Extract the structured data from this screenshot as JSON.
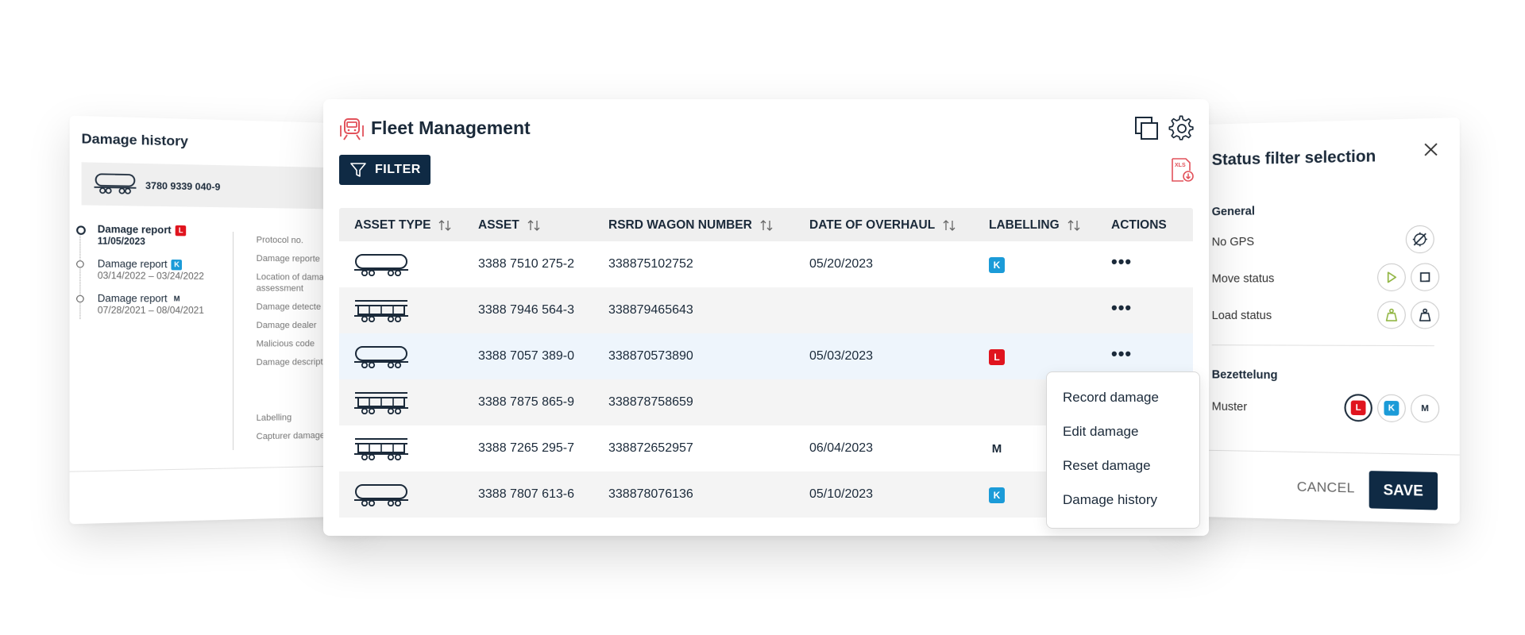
{
  "damage_history": {
    "title": "Damage history",
    "asset_number": "3780 9339 040-9",
    "reports": [
      {
        "title": "Damage report",
        "badge": "L",
        "date": "11/05/2023"
      },
      {
        "title": "Damage report",
        "badge": "K",
        "date": "03/14/2022 – 03/24/2022"
      },
      {
        "title": "Damage report",
        "badge": "M",
        "date": "07/28/2021 – 08/04/2021"
      }
    ],
    "fields": {
      "protocol": "Protocol no.",
      "reported": "Damage reporte",
      "location_1": "Location of dama",
      "location_2": "assessment",
      "detected": "Damage detecte",
      "dealer": "Damage dealer",
      "malicious": "Malicious code",
      "description": "Damage descript",
      "labelling": "Labelling",
      "capturer": "Capturer damage"
    }
  },
  "fleet": {
    "title": "Fleet Management",
    "filter_label": "FILTER",
    "xls_label": "XLS",
    "columns": {
      "asset_type": "ASSET TYPE",
      "asset": "ASSET",
      "rsrd": "RSRD WAGON NUMBER",
      "overhaul": "DATE OF OVERHAUL",
      "labelling": "LABELLING",
      "actions": "ACTIONS"
    },
    "rows": [
      {
        "type": "tank",
        "asset": "3388 7510 275-2",
        "rsrd": "338875102752",
        "overhaul": "05/20/2023",
        "label": "K"
      },
      {
        "type": "hopper",
        "asset": "3388 7946 564-3",
        "rsrd": "338879465643",
        "overhaul": "",
        "label": ""
      },
      {
        "type": "tank",
        "asset": "3388 7057 389-0",
        "rsrd": "338870573890",
        "overhaul": "05/03/2023",
        "label": "L"
      },
      {
        "type": "hopper",
        "asset": "3388 7875 865-9",
        "rsrd": "338878758659",
        "overhaul": "",
        "label": ""
      },
      {
        "type": "hopper",
        "asset": "3388 7265 295-7",
        "rsrd": "338872652957",
        "overhaul": "06/04/2023",
        "label": "M"
      },
      {
        "type": "tank",
        "asset": "3388 7807 613-6",
        "rsrd": "338878076136",
        "overhaul": "05/10/2023",
        "label": "K"
      }
    ],
    "actions_glyph": "•••",
    "context_menu": [
      "Record damage",
      "Edit damage",
      "Reset damage",
      "Damage history"
    ]
  },
  "status_filter": {
    "title": "Status filter selection",
    "general_heading": "General",
    "no_gps": "No GPS",
    "move_status": "Move status",
    "load_status": "Load status",
    "bezettelung_heading": "Bezettelung",
    "muster": "Muster",
    "muster_badges": [
      "L",
      "K",
      "M"
    ],
    "cancel_label": "CANCEL",
    "save_label": "SAVE"
  },
  "colors": {
    "navy": "#0f2a44",
    "label_L": "#e0141e",
    "label_K": "#1b9bd8",
    "accent_red": "#e2525b",
    "move_green": "#8db33c"
  }
}
